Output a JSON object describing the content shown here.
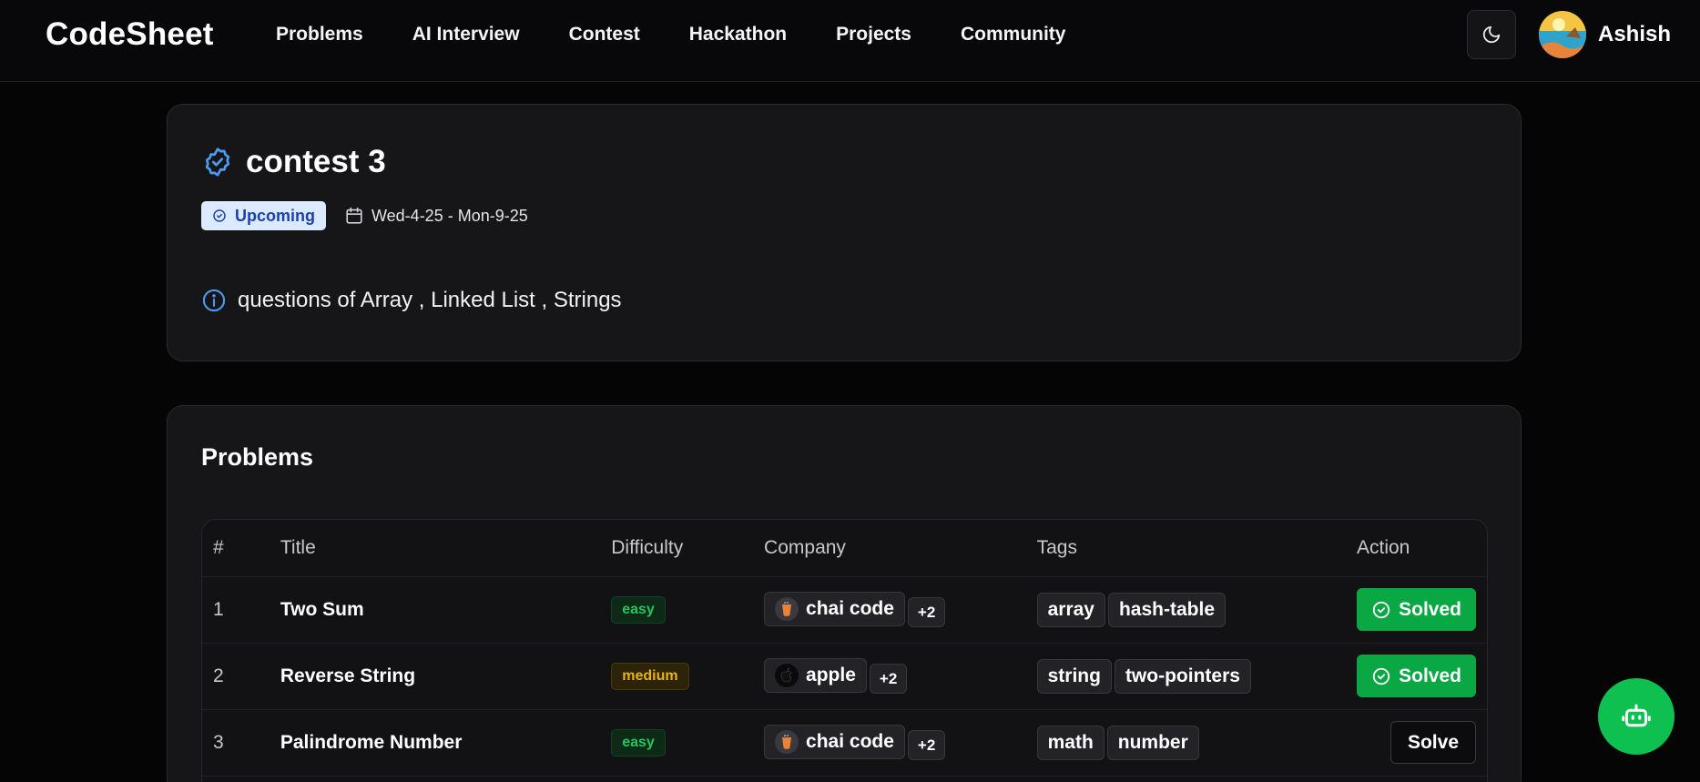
{
  "app": {
    "logo": "CodeSheet"
  },
  "nav": {
    "items": [
      "Problems",
      "AI Interview",
      "Contest",
      "Hackathon",
      "Projects",
      "Community"
    ]
  },
  "user": {
    "name": "Ashish"
  },
  "contest": {
    "title": "contest 3",
    "status": "Upcoming",
    "date_range": "Wed-4-25 - Mon-9-25",
    "description": "questions of Array , Linked List , Strings"
  },
  "problems": {
    "heading": "Problems",
    "columns": [
      "#",
      "Title",
      "Difficulty",
      "Company",
      "Tags",
      "Action"
    ],
    "rows": [
      {
        "num": "1",
        "title": "Two Sum",
        "difficulty": "easy",
        "company": "chai code",
        "company_more": "+2",
        "tags": [
          "array",
          "hash-table"
        ],
        "action": "Solved"
      },
      {
        "num": "2",
        "title": "Reverse String",
        "difficulty": "medium",
        "company": "apple",
        "company_more": "+2",
        "tags": [
          "string",
          "two-pointers"
        ],
        "action": "Solved"
      },
      {
        "num": "3",
        "title": "Palindrome Number",
        "difficulty": "easy",
        "company": "chai code",
        "company_more": "+2",
        "tags": [
          "math",
          "number"
        ],
        "action": "Solve"
      }
    ]
  },
  "colors": {
    "accent_green": "#0aa845",
    "badge_blue": "#dbeafe",
    "icon_blue": "#4d9bf0"
  }
}
